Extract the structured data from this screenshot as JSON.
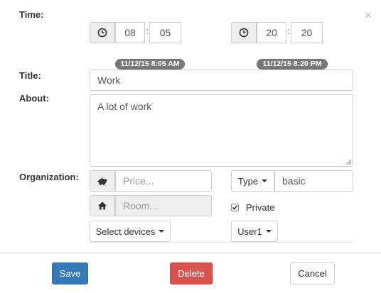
{
  "dialog": {
    "close_symbol": "×"
  },
  "time": {
    "label": "Time:",
    "start": {
      "hours": "08",
      "minutes": "05",
      "separator": ":",
      "badge": "11/12/15 8:05 AM"
    },
    "end": {
      "hours": "20",
      "minutes": "20",
      "separator": ":",
      "badge": "11/12/15 8:20 PM"
    }
  },
  "title": {
    "label": "Title:",
    "value": "Work"
  },
  "about": {
    "label": "About:",
    "value": "A lot of work"
  },
  "organization": {
    "label": "Organization:",
    "price_placeholder": "Price...",
    "room_placeholder": "Room...",
    "type_button": "Type",
    "type_value": "basic",
    "private_label": "Private",
    "private_checked": true,
    "devices_button": "Select devices",
    "user_button": "User1"
  },
  "footer": {
    "save": "Save",
    "delete": "Delete",
    "cancel": "Cancel"
  },
  "colors": {
    "primary": "#337ab7",
    "danger": "#d9534f",
    "badge": "#777777"
  },
  "icons": [
    "clock-icon",
    "piggy-bank-icon",
    "home-icon",
    "close-icon",
    "caret-down-icon",
    "checkbox-icon"
  ]
}
